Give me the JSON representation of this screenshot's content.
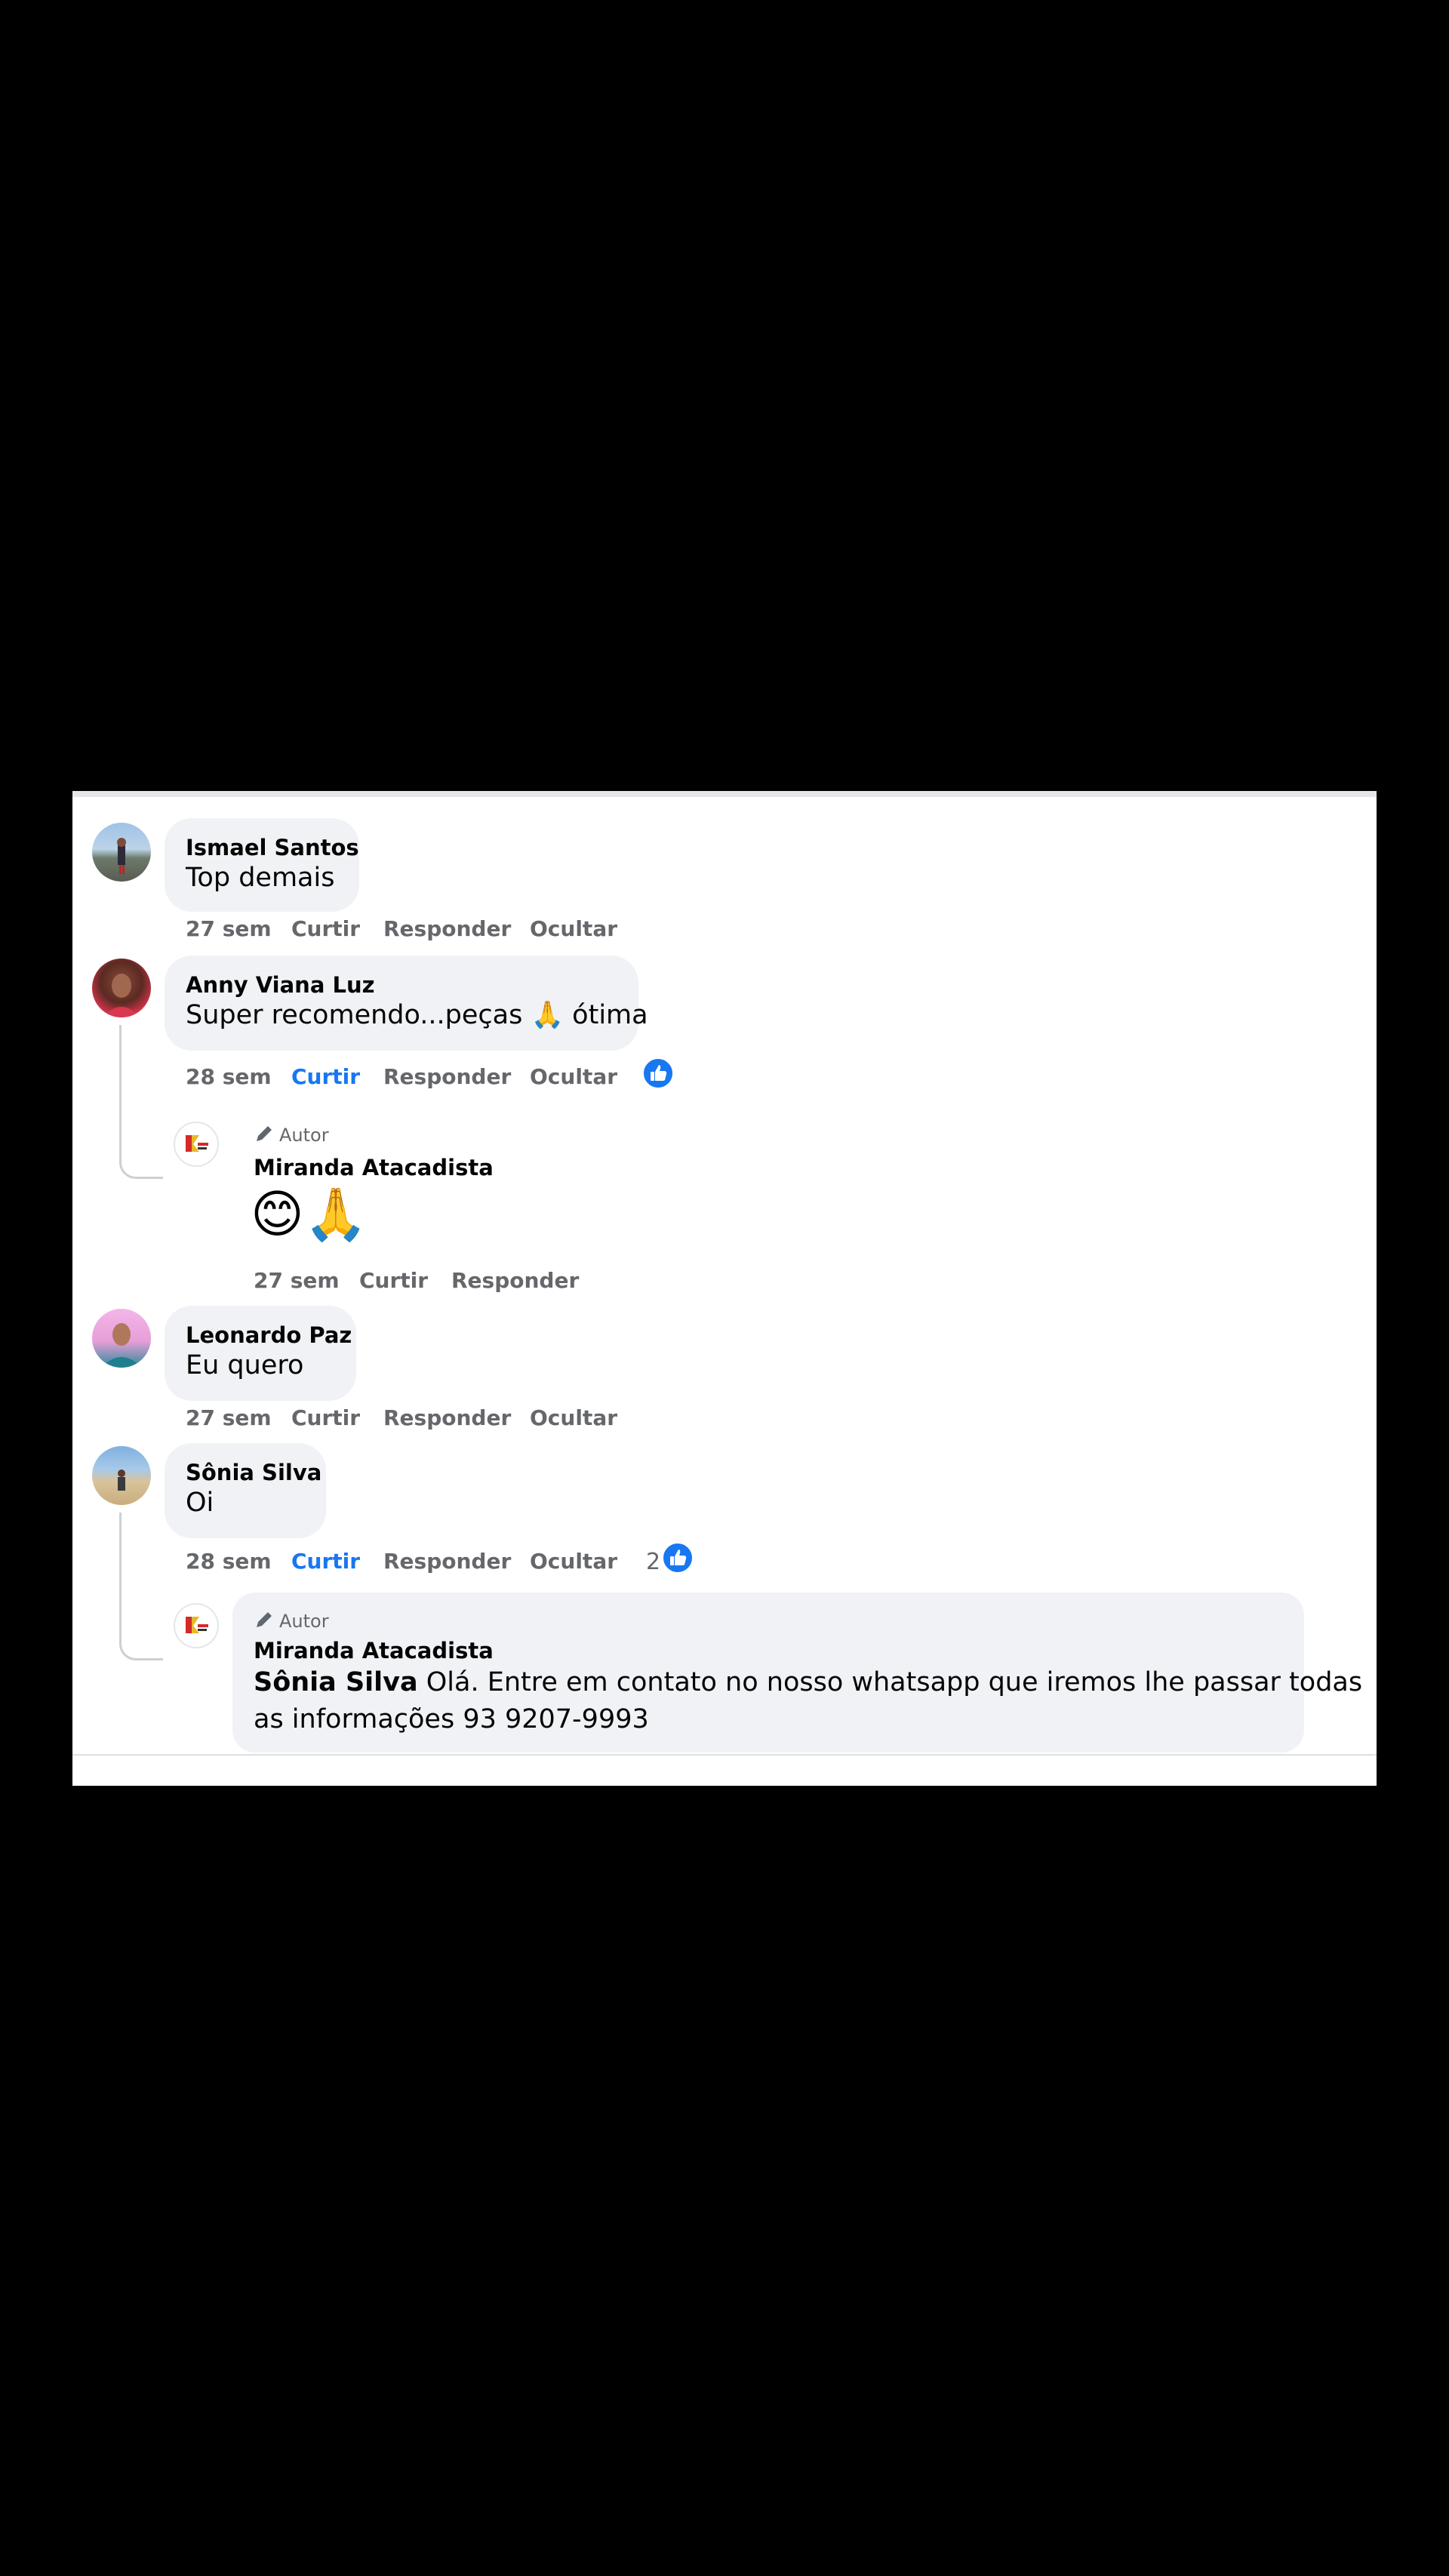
{
  "author_badge": "Autor",
  "actions": {
    "curtir": "Curtir",
    "responder": "Responder",
    "ocultar": "Ocultar"
  },
  "colors": {
    "accent": "#1877f2",
    "bubble": "#f0f2f5",
    "muted": "#65676b"
  },
  "comments": [
    {
      "name": "Ismael Santos",
      "text": "Top demais",
      "time": "27 sem"
    },
    {
      "name": "Anny Viana Luz",
      "text": "Super recomendo...peças 🙏 ótima",
      "time": "28 sem"
    },
    {
      "name": "Leonardo Paz",
      "text": "Eu quero",
      "time": "27 sem"
    },
    {
      "name": "Sônia Silva",
      "text": "Oi",
      "time": "28 sem",
      "like_count": "2"
    }
  ],
  "replies": [
    {
      "name": "Miranda Atacadista",
      "text": "😊🙏",
      "time": "27 sem"
    },
    {
      "name": "Miranda Atacadista",
      "mention": "Sônia Silva",
      "text_line1": "Olá. Entre em contato no nosso whatsapp que iremos lhe passar todas",
      "text_line2": "as informações 93 9207-9993"
    }
  ]
}
